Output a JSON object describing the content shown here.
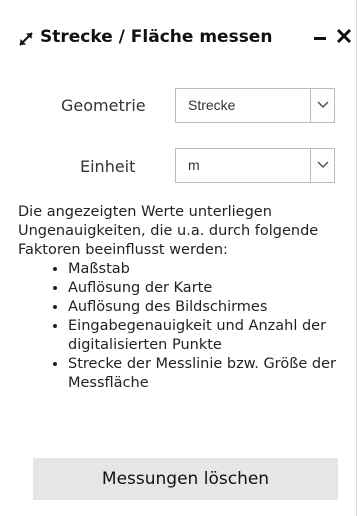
{
  "header": {
    "title": "Strecke / Fläche messen",
    "icon": "resize-diagonal-icon",
    "minimize_icon": "minimize-icon",
    "close_icon": "close-icon"
  },
  "form": {
    "geometry_label": "Geometrie",
    "geometry_value": "Strecke",
    "unit_label": "Einheit",
    "unit_value": "m"
  },
  "info": {
    "intro": "Die angezeigten Werte unterliegen Ungenauigkeiten, die u.a. durch folgende Faktoren beeinflusst werden:",
    "items": [
      "Maßstab",
      "Auflösung der Karte",
      "Auflösung des Bildschirmes",
      "Eingabegenauigkeit und Anzahl der digitalisierten Punkte",
      "Strecke der Messlinie bzw. Größe der Messfläche"
    ]
  },
  "actions": {
    "clear_label": "Messungen löschen"
  }
}
